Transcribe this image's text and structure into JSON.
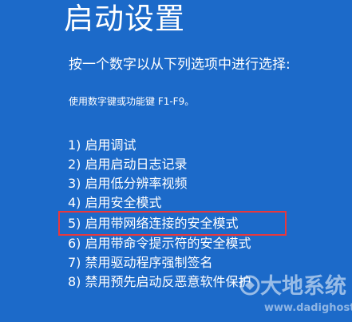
{
  "screen": {
    "title": "启动设置",
    "instruction": "按一个数字以从下列选项中进行选择:",
    "hint": "使用数字键或功能键 F1-F9。",
    "options": [
      {
        "label": "1) 启用调试"
      },
      {
        "label": "2) 启用启动日志记录"
      },
      {
        "label": "3) 启用低分辨率视频"
      },
      {
        "label": "4) 启用安全模式"
      },
      {
        "label": "5) 启用带网络连接的安全模式",
        "highlighted": true
      },
      {
        "label": "6) 启用带命令提示符的安全模式"
      },
      {
        "label": "7) 禁用驱动程序强制签名"
      },
      {
        "label": "8) 禁用预先启动反恶意软件保护"
      }
    ],
    "highlight_color": "#e8383d",
    "background_color": "#1c6ac9"
  },
  "watermark": {
    "text": "大地系统",
    "url": "www.dadighost.com"
  }
}
